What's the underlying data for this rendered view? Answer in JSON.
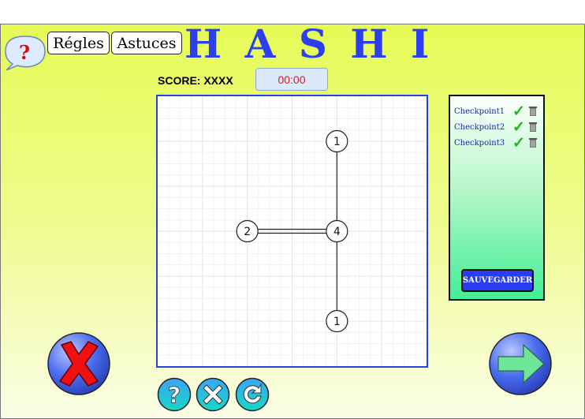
{
  "header": {
    "help_symbol": "?",
    "rules_label": "Régles",
    "tips_label": "Astuces",
    "title": "H A S H I"
  },
  "status": {
    "score_text": "SCORE: XXXX",
    "timer": "00:00"
  },
  "board": {
    "grid_cells": 6,
    "islands": [
      {
        "col": 4,
        "row": 1,
        "value": "1"
      },
      {
        "col": 2,
        "row": 3,
        "value": "2"
      },
      {
        "col": 4,
        "row": 3,
        "value": "4"
      },
      {
        "col": 4,
        "row": 5,
        "value": "1"
      }
    ],
    "bridges": [
      {
        "from": 0,
        "to": 2,
        "count": 1
      },
      {
        "from": 1,
        "to": 2,
        "count": 2
      },
      {
        "from": 2,
        "to": 3,
        "count": 1
      }
    ]
  },
  "checkpoints": {
    "items": [
      {
        "label": "Checkpoint1",
        "check": "✓"
      },
      {
        "label": "Checkpoint2",
        "check": "✓"
      },
      {
        "label": "Checkpoint3",
        "check": "✓"
      }
    ],
    "save_label": "SAUVEGARDER"
  },
  "colors": {
    "title": "#2c3ff0",
    "timer_text": "#e01818",
    "board_border": "#2244dd",
    "check": "#18b818",
    "quit_x": "#ee1111",
    "next_arrow": "#6fe59a"
  }
}
